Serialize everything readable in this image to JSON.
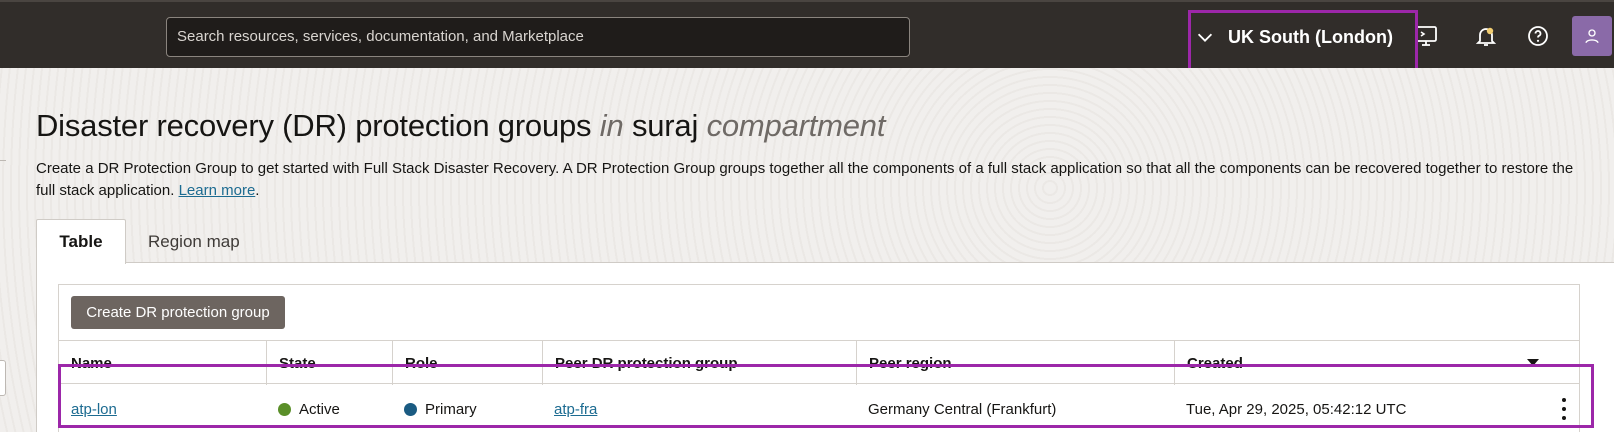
{
  "header": {
    "search_placeholder": "Search resources, services, documentation, and Marketplace",
    "region_label": "UK South (London)",
    "icons": [
      "cloud-shell-icon",
      "bell-icon",
      "help-icon",
      "user-icon"
    ]
  },
  "page": {
    "title_prefix": "Disaster recovery (DR) protection groups",
    "title_in": "in",
    "title_compartment_name": "suraj",
    "title_compartment_word": "compartment",
    "description": "Create a DR Protection Group to get started with Full Stack Disaster Recovery. A DR Protection Group groups together all the components of a full stack application so that all the components can be recovered together to restore the full stack application.",
    "learn_more": "Learn more"
  },
  "tabs": [
    {
      "label": "Table",
      "active": true
    },
    {
      "label": "Region map",
      "active": false
    }
  ],
  "table": {
    "create_button": "Create DR protection group",
    "columns": [
      "Name",
      "State",
      "Role",
      "Peer DR protection group",
      "Peer region",
      "Created"
    ],
    "rows": [
      {
        "name": "atp-lon",
        "state": "Active",
        "role": "Primary",
        "peer_group": "atp-fra",
        "peer_region": "Germany Central (Frankfurt)",
        "created": "Tue, Apr 29, 2025, 05:42:12 UTC"
      }
    ]
  },
  "colors": {
    "topbar": "#312d2a",
    "highlight": "#9c27a9",
    "link": "#1c6b91",
    "state_active": "#5a8f29",
    "role_primary": "#1a5b82",
    "create_button": "#6d6560"
  }
}
